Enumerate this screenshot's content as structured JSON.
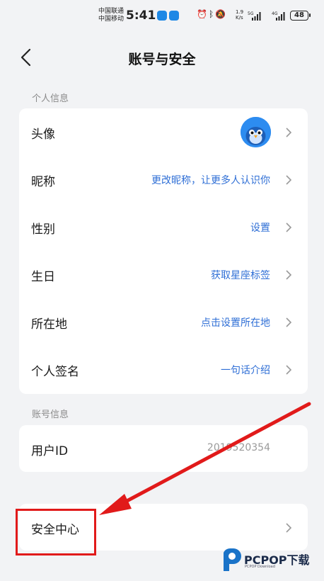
{
  "status_bar": {
    "carrier_1": "中国联通",
    "carrier_2": "中国移动",
    "time": "5:41",
    "net_speed_value": "1.9",
    "net_speed_unit": "K/s",
    "sig1_label": "5G",
    "sig2_label": "4G",
    "battery": "48"
  },
  "header": {
    "title": "账号与安全"
  },
  "personal_section": {
    "label": "个人信息",
    "rows": [
      {
        "label": "头像",
        "value": ""
      },
      {
        "label": "昵称",
        "value": "更改昵称，让更多人认识你"
      },
      {
        "label": "性别",
        "value": "设置"
      },
      {
        "label": "生日",
        "value": "获取星座标签"
      },
      {
        "label": "所在地",
        "value": "点击设置所在地"
      },
      {
        "label": "个人签名",
        "value": "一句话介绍"
      }
    ]
  },
  "account_section": {
    "label": "账号信息",
    "user_id_label": "用户ID",
    "user_id_value": "2019520354"
  },
  "security": {
    "label": "安全中心"
  },
  "watermark": {
    "text": "PCPOP下载",
    "sub": "PCPOP Download"
  },
  "colors": {
    "accent": "#2f6fd6",
    "annotation": "#e11a1a",
    "background": "#f2f3f5"
  }
}
